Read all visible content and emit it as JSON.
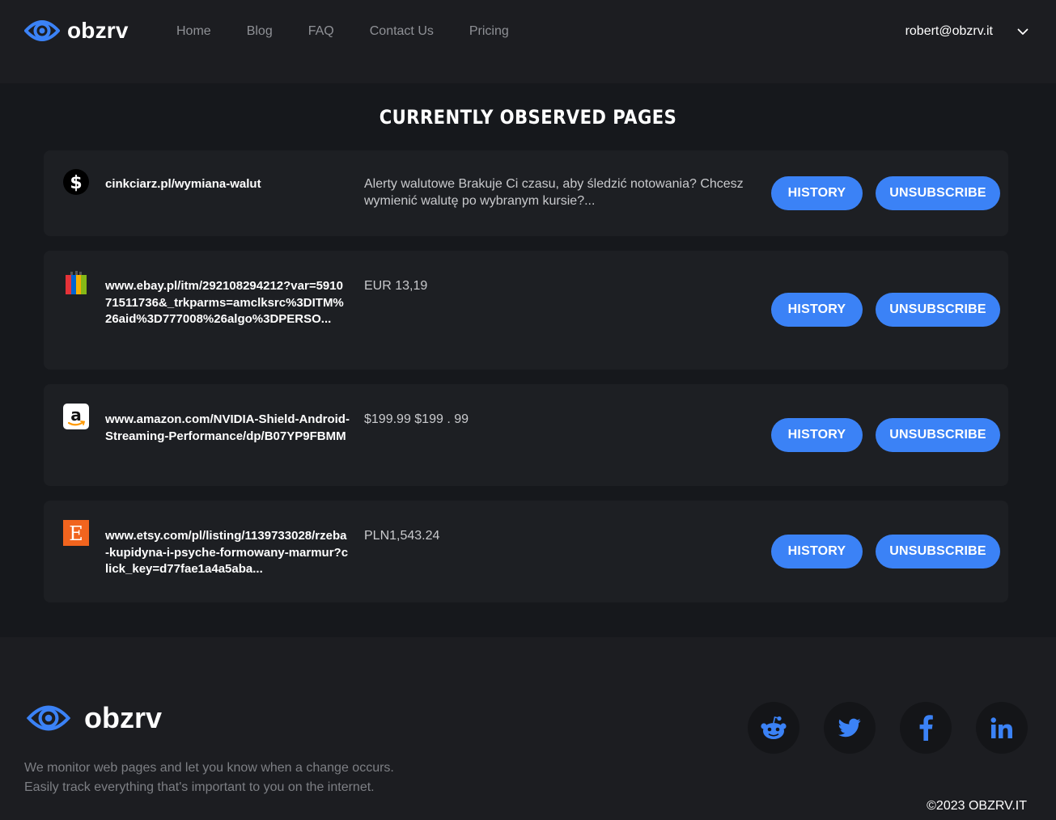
{
  "header": {
    "logo_text": "obzrv",
    "nav": [
      "Home",
      "Blog",
      "FAQ",
      "Contact Us",
      "Pricing"
    ],
    "user_email": "robert@obzrv.it"
  },
  "main": {
    "title": "CURRENTLY OBSERVED PAGES",
    "history_label": "HISTORY",
    "unsubscribe_label": "UNSUBSCRIBE",
    "pages": [
      {
        "favicon": "dollar-icon",
        "url": "cinkciarz.pl/wymiana-walut",
        "content": "Alerty walutowe Brakuje Ci czasu, aby śledzić notowania? Chcesz wymienić walutę po wybranym kursie?..."
      },
      {
        "favicon": "ebay-icon",
        "url": "www.ebay.pl/itm/292108294212?var=591071511736&_trkparms=amclksrc%3DITM%26aid%3D777008%26algo%3DPERSO...",
        "content": "EUR 13,19"
      },
      {
        "favicon": "amazon-icon",
        "url": "www.amazon.com/NVIDIA-Shield-Android-Streaming-Performance/dp/B07YP9FBMM",
        "content": "$199.99 $199 . 99"
      },
      {
        "favicon": "etsy-icon",
        "url": "www.etsy.com/pl/listing/1139733028/rzeba-kupidyna-i-psyche-formowany-marmur?click_key=d77fae1a4a5aba...",
        "content": "PLN1,543.24"
      }
    ]
  },
  "footer": {
    "logo_text": "obzrv",
    "tagline": [
      "We monitor web pages and let you know when a change occurs.",
      "Easily track everything that's important to you on the internet."
    ],
    "socials": [
      "reddit-icon",
      "twitter-icon",
      "facebook-icon",
      "linkedin-icon"
    ],
    "copyright": "©2023 OBZRV.IT"
  },
  "colors": {
    "accent": "#3b82f6",
    "background": "#16181c",
    "card": "#1d1f23",
    "header": "#1c1d21"
  }
}
